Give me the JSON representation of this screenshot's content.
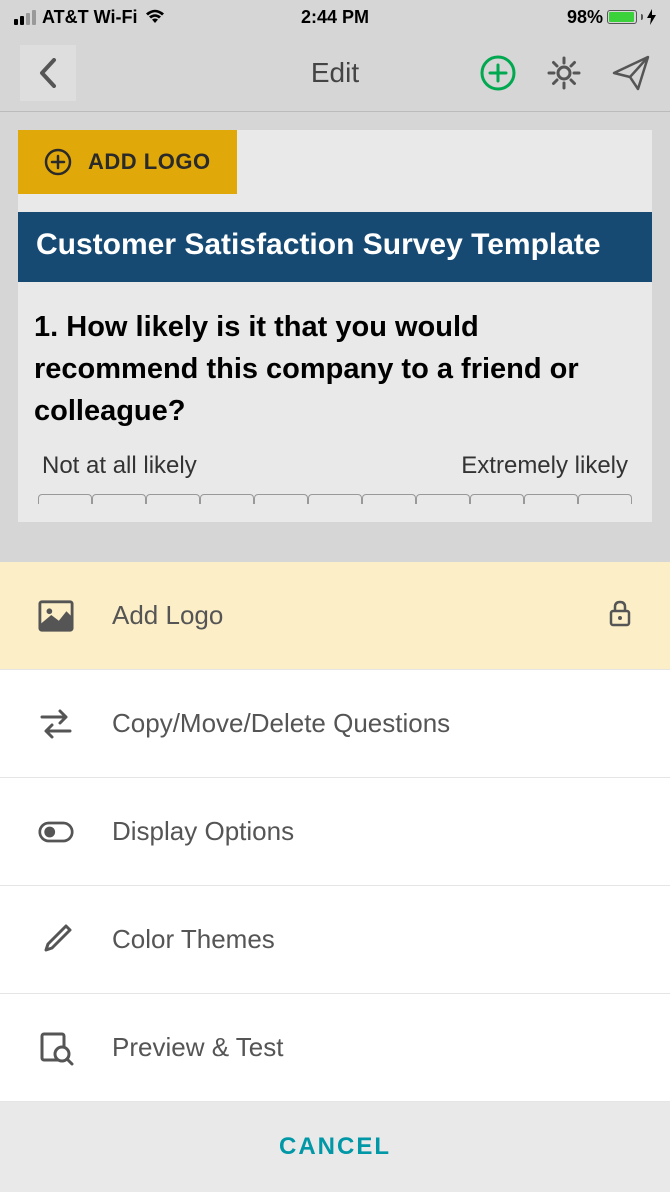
{
  "status_bar": {
    "carrier": "AT&T Wi-Fi",
    "time": "2:44 PM",
    "battery_percent": "98%",
    "battery_fill_pct": 98
  },
  "header": {
    "title": "Edit"
  },
  "survey": {
    "add_logo_label": "ADD LOGO",
    "title": "Customer Satisfaction Survey Template",
    "question1": {
      "number": "1.",
      "text": "How likely is it that you would recommend this company to a friend or colleague?",
      "scale_low": "Not at all likely",
      "scale_high": "Extremely likely"
    }
  },
  "menu": {
    "items": [
      {
        "label": "Add Logo",
        "icon": "image-icon",
        "locked": true,
        "highlighted": true
      },
      {
        "label": "Copy/Move/Delete Questions",
        "icon": "swap-icon",
        "locked": false,
        "highlighted": false
      },
      {
        "label": "Display Options",
        "icon": "toggle-icon",
        "locked": false,
        "highlighted": false
      },
      {
        "label": "Color Themes",
        "icon": "brush-icon",
        "locked": false,
        "highlighted": false
      },
      {
        "label": "Preview & Test",
        "icon": "preview-icon",
        "locked": false,
        "highlighted": false
      }
    ],
    "cancel_label": "CANCEL"
  }
}
